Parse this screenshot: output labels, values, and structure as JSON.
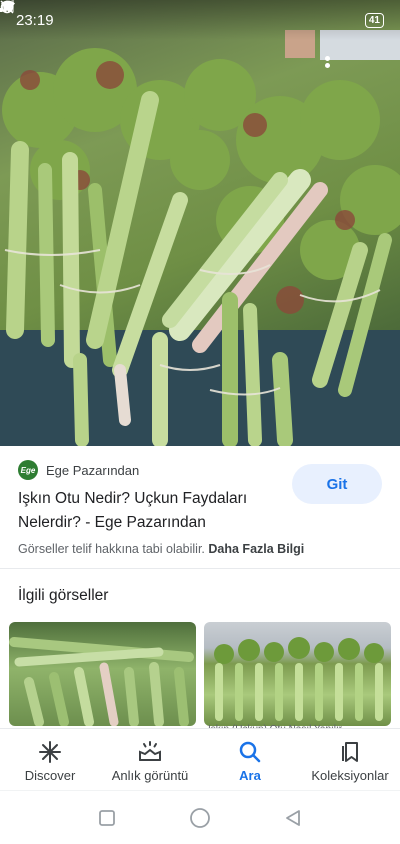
{
  "status_bar": {
    "time": "23:19",
    "battery": "41"
  },
  "result": {
    "source_logo_text": "Ege",
    "source_name": "Ege Pazarından",
    "title": "Işkın Otu Nedir? Uçkun Faydaları Nelerdir? - Ege Pazarından",
    "visit_label": "Git",
    "copyright_text": "Görseller telif hakkına tabi olabilir.",
    "more_info_label": "Daha Fazla Bilgi"
  },
  "related": {
    "heading": "İlgili görseller",
    "thumbnails": [
      {
        "caption": ""
      },
      {
        "caption": "Işkın (Uçkun) Otu Nasıl Yapılır..."
      }
    ]
  },
  "bottom_nav": {
    "items": [
      {
        "label": "Discover",
        "icon": "asterisk-icon",
        "active": false
      },
      {
        "label": "Anlık görüntü",
        "icon": "snapshot-icon",
        "active": false
      },
      {
        "label": "Ara",
        "icon": "search-icon",
        "active": true
      },
      {
        "label": "Koleksiyonlar",
        "icon": "collections-icon",
        "active": false
      }
    ]
  },
  "colors": {
    "accent": "#1a73e8",
    "visit_bg": "#e8f0fe",
    "text_primary": "#202124",
    "text_secondary": "#5f6368"
  }
}
